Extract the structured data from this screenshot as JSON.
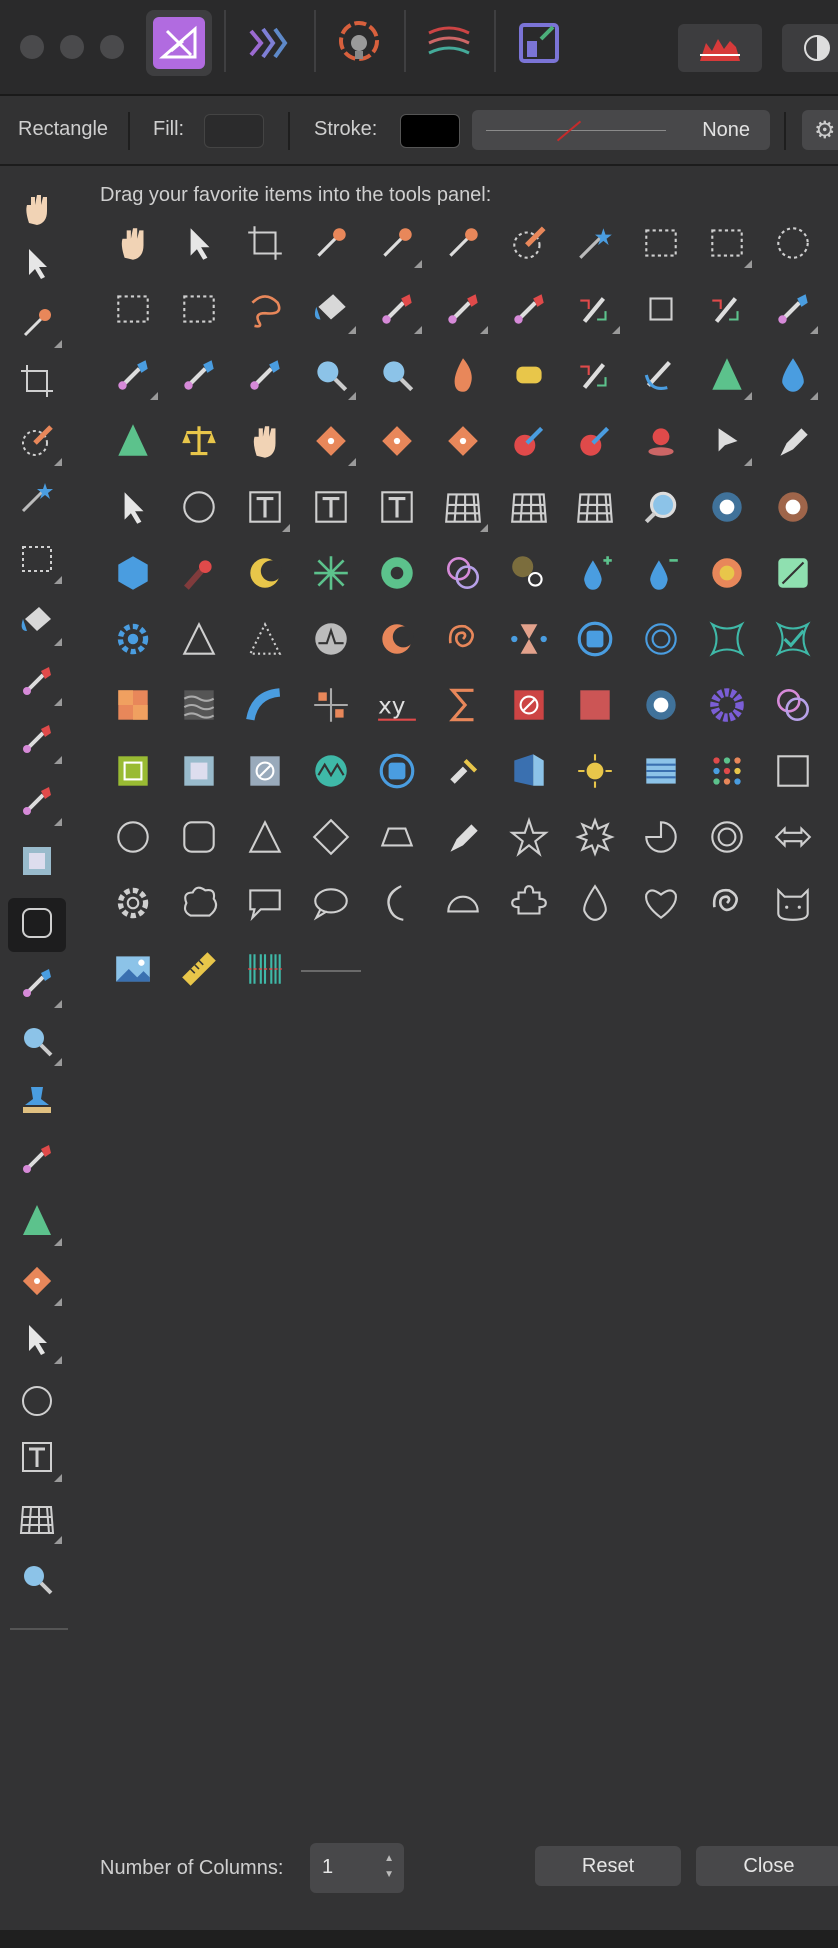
{
  "colors": {
    "accent": "#a463d8",
    "window_bg": "#333334",
    "titlebar_bg": "#2a2a2b",
    "button_bg": "#48484a"
  },
  "personas": [
    {
      "name": "photo-persona-icon",
      "active": true
    },
    {
      "name": "liquify-persona-icon",
      "active": false
    },
    {
      "name": "develop-persona-icon",
      "active": false
    },
    {
      "name": "tone-mapping-persona-icon",
      "active": false
    },
    {
      "name": "export-persona-icon",
      "active": false
    }
  ],
  "context_toolbar": {
    "tool_name": "Rectangle",
    "fill_label": "Fill:",
    "stroke_label": "Stroke:",
    "stroke_style_value": "None",
    "fill_color": "#2b2b2c",
    "stroke_color": "#000000"
  },
  "tools_panel": [
    {
      "name": "view-tool-hand-icon",
      "flyout": false
    },
    {
      "name": "move-tool-icon",
      "flyout": false
    },
    {
      "name": "color-picker-icon",
      "flyout": true
    },
    {
      "name": "crop-tool-icon",
      "flyout": false
    },
    {
      "name": "selection-brush-icon",
      "flyout": true
    },
    {
      "name": "flood-select-icon",
      "flyout": false
    },
    {
      "name": "rectangular-marquee-icon",
      "flyout": true
    },
    {
      "name": "flood-fill-icon",
      "flyout": true
    },
    {
      "name": "paint-brush-icon",
      "flyout": true
    },
    {
      "name": "clone-brush-icon",
      "flyout": true
    },
    {
      "name": "dodge-brush-icon",
      "flyout": true
    },
    {
      "name": "frame-icon",
      "flyout": false
    },
    {
      "name": "rounded-rectangle-icon",
      "flyout": false,
      "selected": true
    },
    {
      "name": "erase-brush-icon",
      "flyout": true
    },
    {
      "name": "zoom-tool-icon",
      "flyout": true
    },
    {
      "name": "stamp-icon",
      "flyout": false
    },
    {
      "name": "smudge-brush-icon",
      "flyout": false
    },
    {
      "name": "sharpen-icon",
      "flyout": true
    },
    {
      "name": "healing-icon",
      "flyout": true
    },
    {
      "name": "node-pointer-icon",
      "flyout": true
    },
    {
      "name": "ellipse-icon",
      "flyout": false
    },
    {
      "name": "text-frame-icon",
      "flyout": true
    },
    {
      "name": "mesh-warp-icon",
      "flyout": true
    },
    {
      "name": "magnifier-icon",
      "flyout": false
    }
  ],
  "customise": {
    "hint": "Drag your favorite items into the tools panel:",
    "items": [
      "hand-icon",
      "pointer-icon",
      "crop-icon",
      "eyedropper-icon",
      "eyedropper-alt-icon",
      "color-picker-icon",
      "selection-brush-icon",
      "magic-wand-icon",
      "rect-marquee-icon",
      "rect-marquee-alt-icon",
      "ellipse-marquee-icon",
      "column-marquee-icon",
      "row-marquee-icon",
      "lasso-icon",
      "fill-bucket-icon",
      "gradient-icon",
      "pixel-brush-icon",
      "paint-brush-icon",
      "color-replace-icon",
      "pixel-select-icon",
      "paint-mixer-icon",
      "erase-icon",
      "background-erase-icon",
      "flood-erase-icon",
      "erase-alt-icon",
      "zoom-icon",
      "zoom-alt-icon",
      "burn-icon",
      "sponge-icon",
      "clone-stamp-icon",
      "smudge-icon",
      "sharpen-icon",
      "blur-drop-icon",
      "sharpen-alt-icon",
      "balance-icon",
      "finger-icon",
      "healing-icon",
      "patch-icon",
      "blemish-icon",
      "inpaint-icon",
      "red-eye-icon",
      "pin-icon",
      "node-icon",
      "pen-icon",
      "node-pointer-icon",
      "ellipse-outline-icon",
      "text-frame-icon",
      "artistic-text-icon",
      "text-box-icon",
      "mesh-warp-icon",
      "perspective-icon",
      "mesh-grid-icon",
      "loupe-icon",
      "glow-icon",
      "sun-icon",
      "cube-icon",
      "comet-icon",
      "crescent-icon",
      "sparkle-icon",
      "aperture-icon",
      "rings-icon",
      "bloom-icon",
      "drop-plus-icon",
      "drop-minus-icon",
      "flower-icon",
      "levels-icon",
      "gear-blue-icon",
      "triangle-outline-icon",
      "triangle-dotted-icon",
      "waveform-icon",
      "half-moon-icon",
      "spiral-icon",
      "hourglass-icon",
      "sphere-icon",
      "target-icon",
      "warp-frame-icon",
      "warp-check-icon",
      "checker-icon",
      "waves-icon",
      "bend-icon",
      "equalizer-icon",
      "xy-icon",
      "sigma-icon",
      "no-entry-icon",
      "halftone-icon",
      "glow-square-icon",
      "donut-icon",
      "overlap-icon",
      "frame-square-icon",
      "frame-blue-icon",
      "no-entry-square-icon",
      "zigzag-icon",
      "globe-icon",
      "flashlight-icon",
      "page-curl-icon",
      "brightness-icon",
      "stripes-icon",
      "dots-icon",
      "square-icon",
      "circle-icon",
      "rounded-square-icon",
      "triangle-icon",
      "diamond-icon",
      "trapezoid-icon",
      "pentagon-icon",
      "star-icon",
      "starburst-icon",
      "pie-icon",
      "donut-outline-icon",
      "double-arrow-icon",
      "cog-icon",
      "cloud-icon",
      "speech-bubble-icon",
      "speech-oval-icon",
      "moon-icon",
      "segment-icon",
      "puzzle-icon",
      "teardrop-icon",
      "heart-icon",
      "spiral-outline-icon",
      "cat-icon",
      "image-icon",
      "ruler-icon",
      "barcode-icon",
      "separator-icon"
    ]
  },
  "footer": {
    "columns_label": "Number of Columns:",
    "columns_value": "1",
    "reset_label": "Reset",
    "close_label": "Close"
  }
}
